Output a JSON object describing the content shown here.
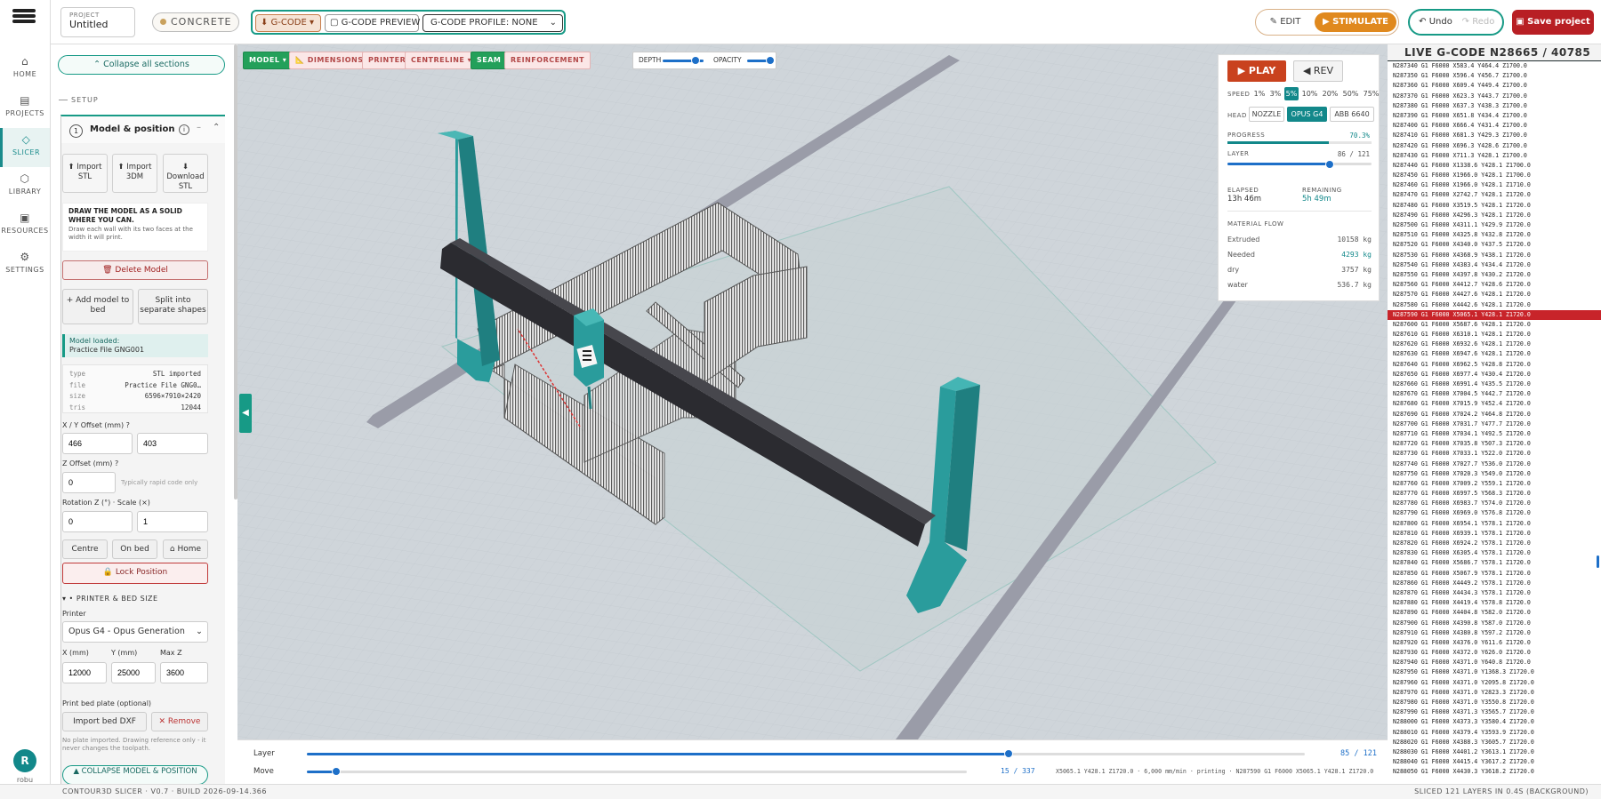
{
  "nav": {
    "items": [
      {
        "label": "HOME",
        "icon": "home-icon",
        "glyph": "⌂"
      },
      {
        "label": "PROJECTS",
        "icon": "projects-icon",
        "glyph": "▤"
      },
      {
        "label": "SLICER",
        "icon": "slicer-icon",
        "glyph": "◇"
      },
      {
        "label": "LIBRARY",
        "icon": "library-icon",
        "glyph": "⬡"
      },
      {
        "label": "RESOURCES",
        "icon": "resources-icon",
        "glyph": "▣"
      },
      {
        "label": "SETTINGS",
        "icon": "settings-icon",
        "glyph": "⚙"
      }
    ],
    "user_initial": "R",
    "user_name": "robu"
  },
  "header": {
    "project_label": "PROJECT",
    "project_name": "Untitled",
    "material": "CONCRETE",
    "gcode_btn": "⬇ G-CODE ▾",
    "gcode_preview_btn": "▢ G-CODE PREVIEW",
    "gcode_profile": "G-CODE PROFILE: NONE",
    "edit_btn": "✎ EDIT",
    "stimulate_btn": "▶ STIMULATE",
    "undo_btn": "↶ Undo",
    "redo_btn": "↷ Redo",
    "save_btn": "▣ Save project"
  },
  "panel": {
    "collapse_all": "⌃ Collapse all sections",
    "setup_label": "SETUP",
    "section_num": "1",
    "section_title": "Model & position",
    "import_stl": "⬆ Import STL",
    "import_3dm": "⬆ Import 3DM",
    "download_stl": "⬇ Download STL",
    "info_title": "DRAW THE MODEL AS A SOLID WHERE YOU CAN.",
    "info_text": "Draw each wall with its two faces at the width it will print.",
    "delete_model": "🗑 Delete Model",
    "add_model": "+ Add model to bed",
    "split_shapes": "Split into separate shapes",
    "model_loaded_label": "Model loaded:",
    "model_loaded_name": "Practice File GNG001",
    "meta": [
      {
        "k": "type",
        "v": "STL imported"
      },
      {
        "k": "file",
        "v": "Practice File GNG0…"
      },
      {
        "k": "size",
        "v": "6596×7910×2420"
      },
      {
        "k": "tris",
        "v": "12044"
      }
    ],
    "xy_label": "X / Y Offset (mm) ?",
    "x_offset": "466",
    "y_offset": "403",
    "z_label": "Z Offset (mm) ?",
    "z_offset": "0",
    "z_hint": "Typically rapid code only",
    "rot_label": "Rotation Z (°) · Scale (×)",
    "rotation": "0",
    "scale": "1",
    "centre_btn": "Centre",
    "onbed_btn": "On bed",
    "home_btn": "⌂ Home",
    "lock_btn": "🔒 Lock Position",
    "printer_section": "▾ • PRINTER & BED SIZE",
    "printer_label": "Printer",
    "printer_value": "Opus G4 - Opus Generation",
    "x_mm_label": "X (mm)",
    "y_mm_label": "Y (mm)",
    "maxz_label": "Max Z",
    "x_mm": "12000",
    "y_mm": "25000",
    "maxz": "3600",
    "bedplate_label": "Print bed plate (optional)",
    "import_dxf": "Import bed DXF",
    "remove_btn": "✕ Remove",
    "plate_note": "No plate imported. Drawing reference only - it never changes the toolpath.",
    "collapse_model": "▲ COLLAPSE MODEL & POSITION"
  },
  "viewport": {
    "tools": [
      "MODEL ▾",
      "📐 DIMENSIONS ▾",
      "PRINTER",
      "CENTRELINE ▾",
      "SEAM",
      "REINFORCEMENT"
    ],
    "depth_label": "DEPTH",
    "opacity_label": "OPACITY",
    "depth_value": 0.8,
    "opacity_value": 0.85
  },
  "player": {
    "play_btn": "▶ PLAY",
    "rev_btn": "◀ REV",
    "speed_label": "SPEED",
    "speeds": [
      "1%",
      "3%",
      "5%",
      "10%",
      "20%",
      "50%",
      "75%"
    ],
    "speed_active": "5%",
    "head_label": "HEAD",
    "heads": [
      "NOZZLE",
      "OPUS G4",
      "ABB 6640"
    ],
    "head_active": "OPUS G4",
    "progress_label": "PROGRESS",
    "progress_text": "70.3%",
    "progress_value": 0.703,
    "layer_label": "LAYER",
    "layer_text": "86 / 121",
    "layer_value": 0.711,
    "elapsed_label": "ELAPSED",
    "elapsed": "13h 46m",
    "remaining_label": "REMAINING",
    "remaining": "5h 49m",
    "flow_label": "MATERIAL FLOW",
    "flow": [
      {
        "k": "Extruded",
        "v": "10158 kg"
      },
      {
        "k": "Needed",
        "v": "4293 kg"
      },
      {
        "k": "dry",
        "v": "3757 kg"
      },
      {
        "k": "water",
        "v": "536.7 kg"
      }
    ]
  },
  "gcode": {
    "title": "LIVE G-CODE",
    "line_count": "N28665 / 40785",
    "lines": [
      "N287340 G1 F6000 X583.4 Y464.4 Z1700.0",
      "N287350 G1 F6000 X596.4 Y456.7 Z1700.0",
      "N287360 G1 F6000 X609.4 Y449.4 Z1700.0",
      "N287370 G1 F6000 X623.3 Y443.7 Z1700.0",
      "N287380 G1 F6000 X637.3 Y438.3 Z1700.0",
      "N287390 G1 F6000 X651.8 Y434.4 Z1700.0",
      "N287400 G1 F6000 X666.4 Y431.4 Z1700.0",
      "N287410 G1 F6000 X681.3 Y429.3 Z1700.0",
      "N287420 G1 F6000 X696.3 Y428.6 Z1700.0",
      "N287430 G1 F6000 X711.3 Y428.1 Z1700.0",
      "N287440 G1 F6000 X1338.6 Y428.1 Z1700.0",
      "N287450 G1 F6000 X1966.0 Y428.1 Z1700.0",
      "N287460 G1 F6000 X1966.0 Y428.1 Z1710.0",
      "N287470 G1 F6000 X2742.7 Y428.1 Z1720.0",
      "N287480 G1 F6000 X3519.5 Y428.1 Z1720.0",
      "N287490 G1 F6000 X4296.3 Y428.1 Z1720.0",
      "N287500 G1 F6000 X4311.1 Y429.9 Z1720.0",
      "N287510 G1 F6000 X4325.8 Y432.8 Z1720.0",
      "N287520 G1 F6000 X4340.0 Y437.5 Z1720.0",
      "N287530 G1 F6000 X4368.9 Y438.1 Z1720.0",
      "N287540 G1 F6000 X4383.4 Y434.4 Z1720.0",
      "N287550 G1 F6000 X4397.8 Y430.2 Z1720.0",
      "N287560 G1 F6000 X4412.7 Y428.6 Z1720.0",
      "N287570 G1 F6000 X4427.6 Y428.1 Z1720.0",
      "N287580 G1 F6000 X4442.6 Y428.1 Z1720.0",
      "N287590 G1 F6000 X5065.1 Y428.1 Z1720.0",
      "N287600 G1 F6000 X5687.6 Y428.1 Z1720.0",
      "N287610 G1 F6000 X6310.1 Y428.1 Z1720.0",
      "N287620 G1 F6000 X6932.6 Y428.1 Z1720.0",
      "N287630 G1 F6000 X6947.6 Y428.1 Z1720.0",
      "N287640 G1 F6000 X6962.5 Y428.8 Z1720.0",
      "N287650 G1 F6000 X6977.4 Y430.4 Z1720.0",
      "N287660 G1 F6000 X6991.4 Y435.5 Z1720.0",
      "N287670 G1 F6000 X7004.5 Y442.7 Z1720.0",
      "N287680 G1 F6000 X7015.9 Y452.4 Z1720.0",
      "N287690 G1 F6000 X7024.2 Y464.8 Z1720.0",
      "N287700 G1 F6000 X7031.7 Y477.7 Z1720.0",
      "N287710 G1 F6000 X7034.1 Y492.5 Z1720.0",
      "N287720 G1 F6000 X7035.8 Y507.3 Z1720.0",
      "N287730 G1 F6000 X7033.1 Y522.0 Z1720.0",
      "N287740 G1 F6000 X7027.7 Y536.0 Z1720.0",
      "N287750 G1 F6000 X7020.3 Y549.0 Z1720.0",
      "N287760 G1 F6000 X7009.2 Y559.1 Z1720.0",
      "N287770 G1 F6000 X6997.5 Y568.3 Z1720.0",
      "N287780 G1 F6000 X6983.7 Y574.0 Z1720.0",
      "N287790 G1 F6000 X6969.0 Y576.8 Z1720.0",
      "N287800 G1 F6000 X6954.1 Y578.1 Z1720.0",
      "N287810 G1 F6000 X6939.1 Y578.1 Z1720.0",
      "N287820 G1 F6000 X6924.2 Y578.1 Z1720.0",
      "N287830 G1 F6000 X6305.4 Y578.1 Z1720.0",
      "N287840 G1 F6000 X5686.7 Y578.1 Z1720.0",
      "N287850 G1 F6000 X5067.9 Y578.1 Z1720.0",
      "N287860 G1 F6000 X4449.2 Y578.1 Z1720.0",
      "N287870 G1 F6000 X4434.3 Y578.1 Z1720.0",
      "N287880 G1 F6000 X4419.4 Y578.8 Z1720.0",
      "N287890 G1 F6000 X4404.8 Y582.0 Z1720.0",
      "N287900 G1 F6000 X4390.8 Y587.0 Z1720.0",
      "N287910 G1 F6000 X4380.8 Y597.2 Z1720.0",
      "N287920 G1 F6000 X4376.0 Y611.6 Z1720.0",
      "N287930 G1 F6000 X4372.0 Y626.0 Z1720.0",
      "N287940 G1 F6000 X4371.0 Y640.8 Z1720.0",
      "N287950 G1 F6000 X4371.0 Y1368.3 Z1720.0",
      "N287960 G1 F6000 X4371.0 Y2095.8 Z1720.0",
      "N287970 G1 F6000 X4371.0 Y2823.3 Z1720.0",
      "N287980 G1 F6000 X4371.0 Y3550.8 Z1720.0",
      "N287990 G1 F6000 X4371.3 Y3565.7 Z1720.0",
      "N288000 G1 F6000 X4373.3 Y3580.4 Z1720.0",
      "N288010 G1 F6000 X4379.4 Y3593.9 Z1720.0",
      "N288020 G1 F6000 X4388.3 Y3605.7 Z1720.0",
      "N288030 G1 F6000 X4401.2 Y3613.1 Z1720.0",
      "N288040 G1 F6000 X4415.4 Y3617.2 Z1720.0",
      "N288050 G1 F6000 X4430.3 Y3618.2 Z1720.0"
    ],
    "current_index": 25
  },
  "bottom": {
    "layer_label": "Layer",
    "layer_text": "85 / 121",
    "layer_value": 0.703,
    "move_label": "Move",
    "move_text": "15 / 337",
    "move_value": 0.045,
    "move_detail": "X5065.1 Y428.1 Z1720.0 · 6,000 mm/min · printing · N287590 G1 F6000 X5065.1 Y428.1 Z1720.0"
  },
  "status": {
    "left": "CONTOUR3D SLICER · V0.7 · BUILD 2026-09-14.366",
    "right": "SLICED 121 LAYERS IN 0.4S (BACKGROUND)"
  },
  "colors": {
    "accent": "#179a86",
    "teal_frame": "#2a9c9c",
    "gantry_beam": "#2b2b30",
    "save_red": "#b81f24",
    "stimulate_orange": "#e0891e",
    "progress": "#12888a"
  }
}
